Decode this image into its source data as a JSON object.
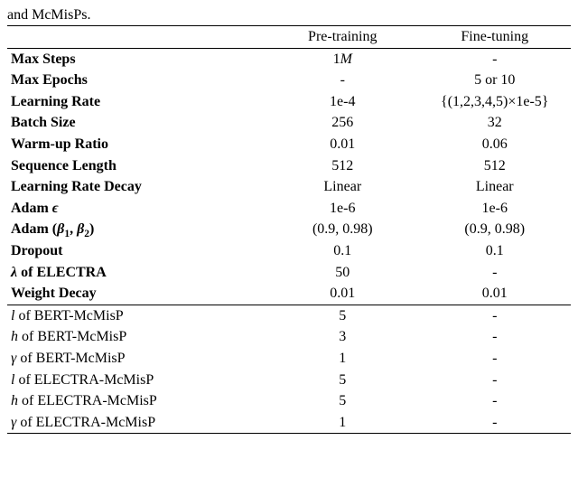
{
  "caption": "and McMisPs.",
  "headers": {
    "pre": "Pre-training",
    "ft": "Fine-tuning"
  },
  "g1": {
    "max_steps": {
      "label": "Max Steps",
      "pre_html": "1<span class='mi'>M</span>",
      "ft": "-"
    },
    "max_epochs": {
      "label": "Max Epochs",
      "pre": "-",
      "ft": "5 or 10"
    },
    "lr": {
      "label": "Learning Rate",
      "pre": "1e-4",
      "ft": "{(1,2,3,4,5)×1e-5}"
    },
    "batch": {
      "label": "Batch Size",
      "pre": "256",
      "ft": "32"
    },
    "warmup": {
      "label": "Warm-up Ratio",
      "pre": "0.01",
      "ft": "0.06"
    },
    "seqlen": {
      "label": "Sequence Length",
      "pre": "512",
      "ft": "512"
    },
    "lrdecay": {
      "label": "Learning Rate Decay",
      "pre": "Linear",
      "ft": "Linear"
    },
    "adam_eps": {
      "label_html": "Adam <span class='mi'>ϵ</span>",
      "pre": "1e-6",
      "ft": "1e-6"
    },
    "adam_betas": {
      "label_html": "Adam (<span class='mi'>β</span><span class='sub'>1</span>, <span class='mi'>β</span><span class='sub'>2</span>)",
      "pre": "(0.9, 0.98)",
      "ft": "(0.9, 0.98)"
    },
    "dropout": {
      "label": "Dropout",
      "pre": "0.1",
      "ft": "0.1"
    },
    "lambda": {
      "label_html": "<span class='mi'>λ</span> of ELECTRA",
      "pre": "50",
      "ft": "-"
    },
    "wdecay": {
      "label": "Weight Decay",
      "pre": "0.01",
      "ft": "0.01"
    }
  },
  "g2": {
    "bert_l": {
      "label_html": "<span class='mi'>l</span> of BERT-McMisP",
      "pre": "5",
      "ft": "-"
    },
    "bert_h": {
      "label_html": "<span class='mi'>h</span> of BERT-McMisP",
      "pre": "3",
      "ft": "-"
    },
    "bert_g": {
      "label_html": "<span class='mi'>γ</span> of BERT-McMisP",
      "pre": "1",
      "ft": "-"
    },
    "electra_l": {
      "label_html": "<span class='mi'>l</span> of ELECTRA-McMisP",
      "pre": "5",
      "ft": "-"
    },
    "electra_h": {
      "label_html": "<span class='mi'>h</span> of ELECTRA-McMisP",
      "pre": "5",
      "ft": "-"
    },
    "electra_g": {
      "label_html": "<span class='mi'>γ</span> of ELECTRA-McMisP",
      "pre": "1",
      "ft": "-"
    }
  }
}
